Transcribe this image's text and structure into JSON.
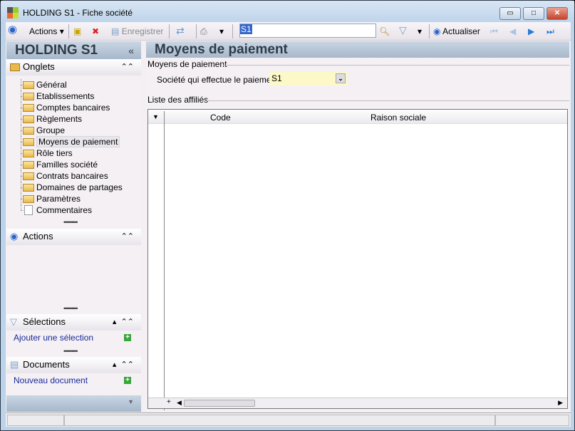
{
  "window": {
    "title": "HOLDING S1 -  Fiche société",
    "minimize": "▭",
    "maximize": "□",
    "close": "✕"
  },
  "toolbar": {
    "actions": "Actions",
    "save": "Enregistrer",
    "search_value": "S1",
    "refresh": "Actualiser"
  },
  "left_panel": {
    "title": "HOLDING S1",
    "collapse": "«",
    "onglets": {
      "title": "Onglets",
      "items": [
        "Général",
        "Etablissements",
        "Comptes bancaires",
        "Règlements",
        "Groupe",
        "Moyens de paiement",
        "Rôle tiers",
        "Familles société",
        "Contrats bancaires",
        "Domaines de partages",
        "Paramètres",
        "Commentaires"
      ],
      "selected": "Moyens de paiement"
    },
    "actions": {
      "title": "Actions"
    },
    "selections": {
      "title": "Sélections",
      "link": "Ajouter une sélection"
    },
    "documents": {
      "title": "Documents",
      "link": "Nouveau document"
    }
  },
  "main": {
    "title": "Moyens de paiement",
    "group_title": "Moyens de paiement",
    "payer_label": "Société qui effectue le paiement :",
    "payer_value": "S1",
    "list_title": "Liste des affiliés",
    "columns": [
      "Code",
      "Raison sociale"
    ]
  }
}
